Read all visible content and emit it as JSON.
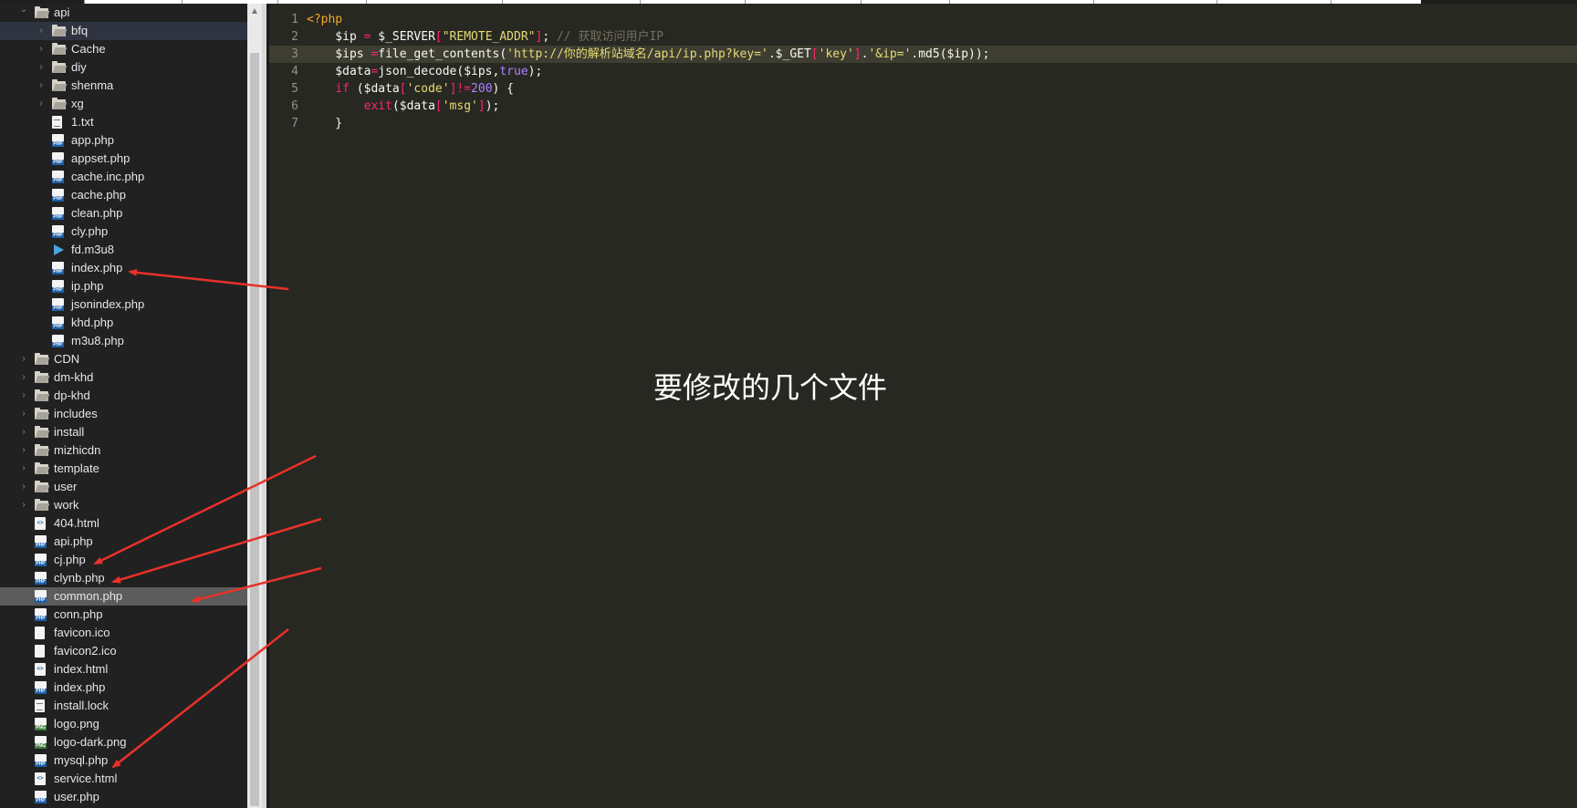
{
  "sidebar": {
    "items": [
      {
        "label": "api",
        "type": "folder",
        "indent": 1,
        "expanded": true
      },
      {
        "label": "bfq",
        "type": "folder",
        "indent": 2,
        "expanded": false,
        "highlight": true
      },
      {
        "label": "Cache",
        "type": "folder",
        "indent": 2,
        "expanded": false
      },
      {
        "label": "diy",
        "type": "folder",
        "indent": 2,
        "expanded": false
      },
      {
        "label": "shenma",
        "type": "folder",
        "indent": 2,
        "expanded": false
      },
      {
        "label": "xg",
        "type": "folder",
        "indent": 2,
        "expanded": false
      },
      {
        "label": "1.txt",
        "type": "txt",
        "indent": 2
      },
      {
        "label": "app.php",
        "type": "php",
        "indent": 2
      },
      {
        "label": "appset.php",
        "type": "php",
        "indent": 2
      },
      {
        "label": "cache.inc.php",
        "type": "php",
        "indent": 2
      },
      {
        "label": "cache.php",
        "type": "php",
        "indent": 2
      },
      {
        "label": "clean.php",
        "type": "php",
        "indent": 2
      },
      {
        "label": "cly.php",
        "type": "php",
        "indent": 2
      },
      {
        "label": "fd.m3u8",
        "type": "media",
        "indent": 2
      },
      {
        "label": "index.php",
        "type": "php",
        "indent": 2
      },
      {
        "label": "ip.php",
        "type": "php",
        "indent": 2
      },
      {
        "label": "jsonindex.php",
        "type": "php",
        "indent": 2
      },
      {
        "label": "khd.php",
        "type": "php",
        "indent": 2
      },
      {
        "label": "m3u8.php",
        "type": "php",
        "indent": 2
      },
      {
        "label": "CDN",
        "type": "folder",
        "indent": 1,
        "expanded": false
      },
      {
        "label": "dm-khd",
        "type": "folder",
        "indent": 1,
        "expanded": false
      },
      {
        "label": "dp-khd",
        "type": "folder",
        "indent": 1,
        "expanded": false
      },
      {
        "label": "includes",
        "type": "folder",
        "indent": 1,
        "expanded": false
      },
      {
        "label": "install",
        "type": "folder",
        "indent": 1,
        "expanded": false
      },
      {
        "label": "mizhicdn",
        "type": "folder",
        "indent": 1,
        "expanded": false
      },
      {
        "label": "template",
        "type": "folder",
        "indent": 1,
        "expanded": false
      },
      {
        "label": "user",
        "type": "folder",
        "indent": 1,
        "expanded": false
      },
      {
        "label": "work",
        "type": "folder",
        "indent": 1,
        "expanded": false
      },
      {
        "label": "404.html",
        "type": "html",
        "indent": 1
      },
      {
        "label": "api.php",
        "type": "php",
        "indent": 1
      },
      {
        "label": "cj.php",
        "type": "php",
        "indent": 1
      },
      {
        "label": "clynb.php",
        "type": "php",
        "indent": 1
      },
      {
        "label": "common.php",
        "type": "php",
        "indent": 1,
        "selected": true
      },
      {
        "label": "conn.php",
        "type": "php",
        "indent": 1
      },
      {
        "label": "favicon.ico",
        "type": "blank",
        "indent": 1
      },
      {
        "label": "favicon2.ico",
        "type": "blank",
        "indent": 1
      },
      {
        "label": "index.html",
        "type": "html",
        "indent": 1
      },
      {
        "label": "index.php",
        "type": "php",
        "indent": 1
      },
      {
        "label": "install.lock",
        "type": "txt",
        "indent": 1
      },
      {
        "label": "logo.png",
        "type": "png",
        "indent": 1
      },
      {
        "label": "logo-dark.png",
        "type": "png",
        "indent": 1
      },
      {
        "label": "mysql.php",
        "type": "php",
        "indent": 1
      },
      {
        "label": "service.html",
        "type": "html",
        "indent": 1
      },
      {
        "label": "user.php",
        "type": "php",
        "indent": 1
      }
    ]
  },
  "editor": {
    "lines": [
      {
        "num": "1",
        "tokens": [
          {
            "t": "<?php",
            "c": "php-open"
          }
        ]
      },
      {
        "num": "2",
        "tokens": [
          {
            "t": "    $ip ",
            "c": "c-var"
          },
          {
            "t": "=",
            "c": "c-op"
          },
          {
            "t": " $_SERVER",
            "c": "c-var"
          },
          {
            "t": "[",
            "c": "c-op"
          },
          {
            "t": "\"REMOTE_ADDR\"",
            "c": "c-str"
          },
          {
            "t": "]",
            "c": "c-op"
          },
          {
            "t": "; ",
            "c": "c-var"
          },
          {
            "t": "// 获取访问用户IP",
            "c": "c-com"
          }
        ]
      },
      {
        "num": "3",
        "active": true,
        "tokens": [
          {
            "t": "    $ips ",
            "c": "c-var"
          },
          {
            "t": "=",
            "c": "c-op"
          },
          {
            "t": "file_get_contents(",
            "c": "c-fn"
          },
          {
            "t": "'http://你的解析站域名/api/ip.php?key='",
            "c": "c-str"
          },
          {
            "t": ".$_GET",
            "c": "c-var"
          },
          {
            "t": "[",
            "c": "c-op"
          },
          {
            "t": "'key'",
            "c": "c-str"
          },
          {
            "t": "]",
            "c": "c-op"
          },
          {
            "t": ".",
            "c": "c-var"
          },
          {
            "t": "'&ip='",
            "c": "c-str"
          },
          {
            "t": ".md5($ip));",
            "c": "c-var"
          }
        ]
      },
      {
        "num": "4",
        "tokens": [
          {
            "t": "    $data",
            "c": "c-var"
          },
          {
            "t": "=",
            "c": "c-op"
          },
          {
            "t": "json_decode($ips,",
            "c": "c-fn"
          },
          {
            "t": "true",
            "c": "c-const"
          },
          {
            "t": ");",
            "c": "c-var"
          }
        ]
      },
      {
        "num": "5",
        "tokens": [
          {
            "t": "    ",
            "c": "c-var"
          },
          {
            "t": "if",
            "c": "c-kw"
          },
          {
            "t": " ($data",
            "c": "c-var"
          },
          {
            "t": "[",
            "c": "c-op"
          },
          {
            "t": "'code'",
            "c": "c-str"
          },
          {
            "t": "]",
            "c": "c-op"
          },
          {
            "t": "!=",
            "c": "c-op"
          },
          {
            "t": "200",
            "c": "c-num"
          },
          {
            "t": ") {",
            "c": "c-var"
          }
        ]
      },
      {
        "num": "6",
        "tokens": [
          {
            "t": "        ",
            "c": "c-var"
          },
          {
            "t": "exit",
            "c": "c-kw"
          },
          {
            "t": "($data",
            "c": "c-var"
          },
          {
            "t": "[",
            "c": "c-op"
          },
          {
            "t": "'msg'",
            "c": "c-str"
          },
          {
            "t": "]",
            "c": "c-op"
          },
          {
            "t": ");",
            "c": "c-var"
          }
        ]
      },
      {
        "num": "7",
        "tokens": [
          {
            "t": "    }",
            "c": "c-var"
          }
        ]
      }
    ]
  },
  "annotation": {
    "text": "要修改的几个文件"
  },
  "colors": {
    "arrow": "#e8312a",
    "editor_bg": "#272822",
    "sidebar_bg": "#212121"
  }
}
